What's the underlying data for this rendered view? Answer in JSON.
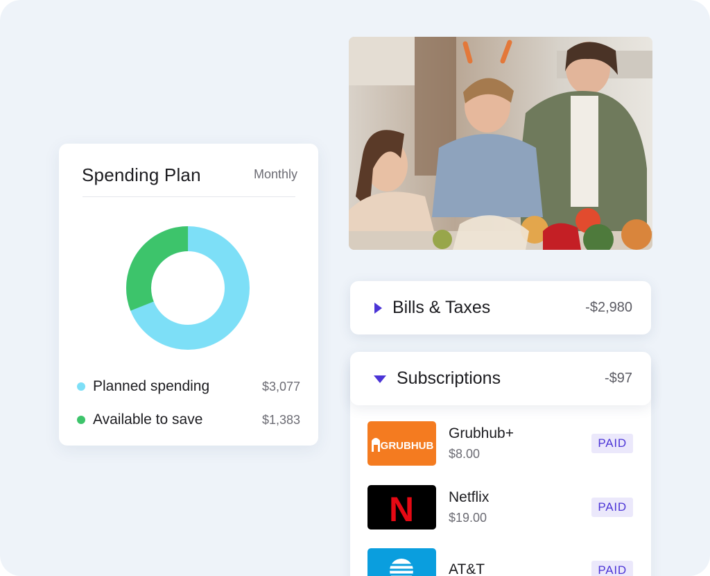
{
  "spending_plan": {
    "title": "Spending Plan",
    "period": "Monthly",
    "legend": [
      {
        "label": "Planned spending",
        "value": "$3,077",
        "color": "#7ddff7"
      },
      {
        "label": "Available to save",
        "value": "$1,383",
        "color": "#3dc46b"
      }
    ]
  },
  "photo": {
    "icon": "family-kitchen-photo"
  },
  "categories": {
    "bills": {
      "title": "Bills & Taxes",
      "amount": "-$2,980",
      "state": "collapsed"
    },
    "subscriptions": {
      "title": "Subscriptions",
      "amount": "-$97",
      "state": "expanded"
    }
  },
  "subscriptions": [
    {
      "name": "Grubhub+",
      "price": "$8.00",
      "status": "PAID",
      "logo_text": "GRUBHUB",
      "logo_color": "#f47b20"
    },
    {
      "name": "Netflix",
      "price": "$19.00",
      "status": "PAID",
      "logo_text": "N",
      "logo_color": "#000000"
    },
    {
      "name": "AT&T",
      "price": "",
      "status": "PAID",
      "logo_text": "",
      "logo_color": "#0a9ede"
    }
  ],
  "colors": {
    "accent": "#4b34d6",
    "planned": "#7ddff7",
    "available": "#3dc46b"
  }
}
